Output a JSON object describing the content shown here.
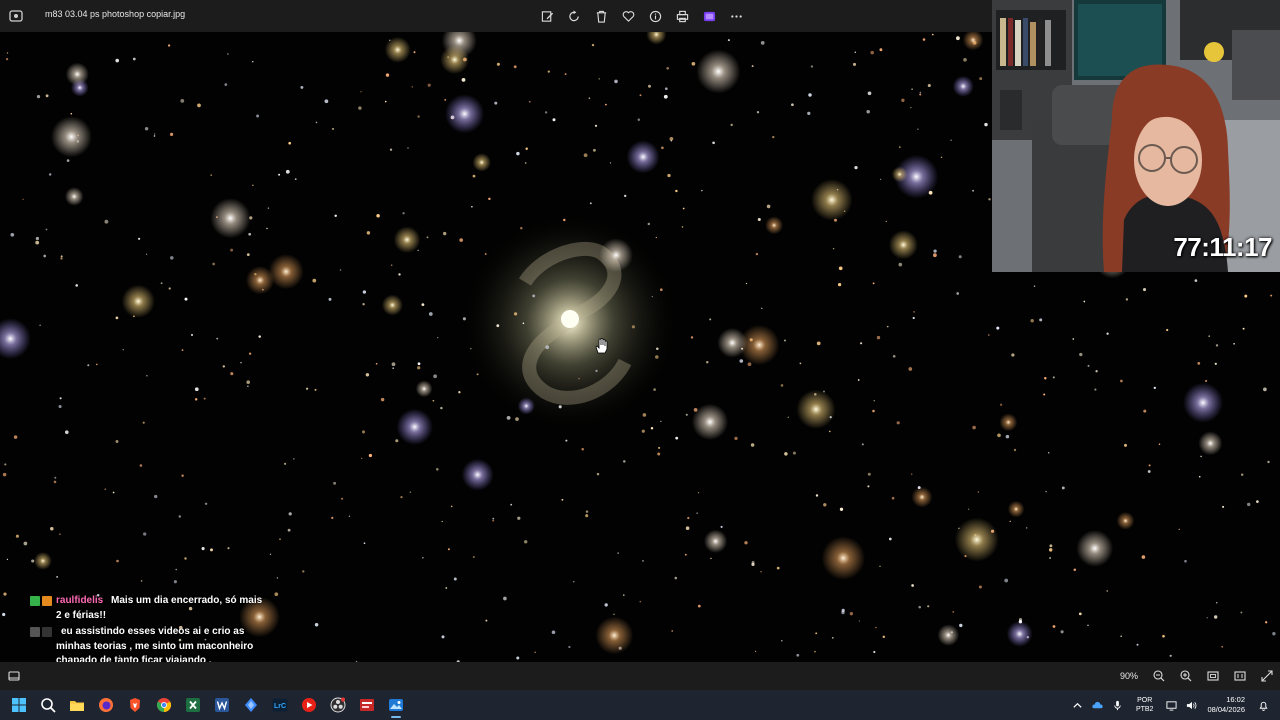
{
  "window": {
    "filename": "m83  03.04 ps photoshop copiar.jpg",
    "toolbar_icons": [
      "edit-icon",
      "rotate-icon",
      "delete-icon",
      "favorite-icon",
      "info-icon",
      "print-icon",
      "clipchamp-icon",
      "more-icon"
    ]
  },
  "stream": {
    "timer": "77:11:17"
  },
  "chat": [
    {
      "username": "raulfidelis",
      "user_color": "#ff69b4",
      "message": "Mais um dia encerrado, só mais 2 e férias!!"
    },
    {
      "username": "",
      "user_color": "#1e3cff",
      "message": "eu assistindo esses videos ai e crio as minhas teorias , me sinto um maconheiro chapado de tanto ficar viajando ."
    }
  ],
  "statusbar": {
    "zoom": "90%"
  },
  "taskbar": {
    "apps": [
      "windows-start-icon",
      "search-icon",
      "file-explorer-icon",
      "firefox-icon",
      "brave-icon",
      "chrome-icon",
      "excel-icon",
      "word-icon",
      "app-icon",
      "lrc-icon",
      "youtube-icon",
      "obs-icon",
      "video-app-icon",
      "photos-icon"
    ],
    "lrc_label": "LrC",
    "lang_top": "POR",
    "lang_bottom": "PTB2",
    "time": "16:02",
    "date": "08/04/2026"
  },
  "colors": {
    "titlebar_bg": "#1c1c1c",
    "taskbar_bg": "#1f2530",
    "accent": "#76b9ed"
  }
}
